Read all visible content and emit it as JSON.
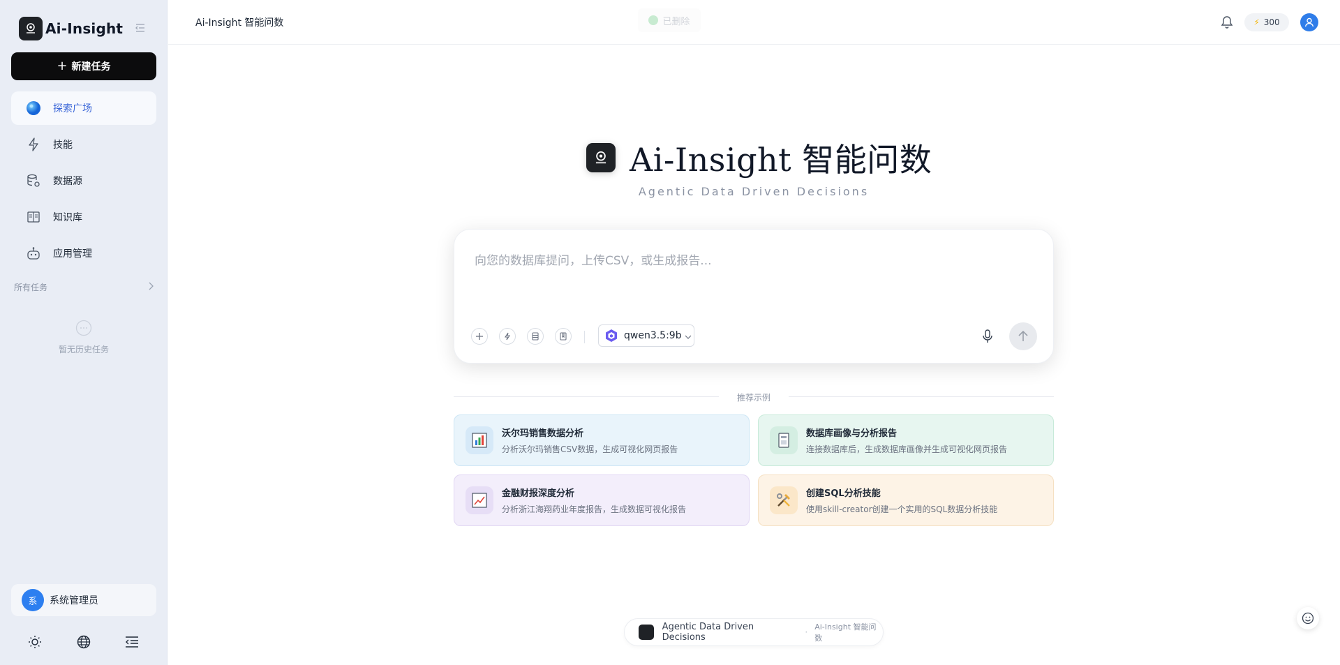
{
  "app": {
    "name": "Ai-Insight",
    "header_title": "Ai-Insight 智能问数",
    "toast_text": "已删除",
    "credits": "300"
  },
  "sidebar": {
    "new_task_label": "新建任务",
    "items": [
      {
        "label": "探索广场",
        "icon": "globe-icon",
        "active": true
      },
      {
        "label": "技能",
        "icon": "lightning-icon",
        "active": false
      },
      {
        "label": "数据源",
        "icon": "database-icon",
        "active": false
      },
      {
        "label": "知识库",
        "icon": "book-icon",
        "active": false
      },
      {
        "label": "应用管理",
        "icon": "robot-icon",
        "active": false
      }
    ],
    "all_tasks_label": "所有任务",
    "empty_text": "暂无历史任务",
    "user": {
      "avatar_text": "系",
      "name": "系统管理员"
    }
  },
  "hero": {
    "title": "Ai-Insight 智能问数",
    "subtitle": "Agentic Data Driven Decisions"
  },
  "composer": {
    "placeholder": "向您的数据库提问，上传CSV，或生成报告...",
    "model": "qwen3.5:9b"
  },
  "examples": {
    "label": "推荐示例",
    "cards": [
      {
        "title": "沃尔玛销售数据分析",
        "desc": "分析沃尔玛销售CSV数据，生成可视化网页报告",
        "icon": "bar-chart-icon"
      },
      {
        "title": "数据库画像与分析报告",
        "desc": "连接数据库后，生成数据库画像并生成可视化网页报告",
        "icon": "report-icon"
      },
      {
        "title": "金融财报深度分析",
        "desc": "分析浙江海翔药业年度报告，生成数据可视化报告",
        "icon": "trend-chart-icon"
      },
      {
        "title": "创建SQL分析技能",
        "desc": "使用skill-creator创建一个实用的SQL数据分析技能",
        "icon": "tools-icon"
      }
    ]
  },
  "footer": {
    "main": "Agentic Data Driven Decisions",
    "separator": "·",
    "sub": "Ai-Insight 智能问数"
  },
  "colors": {
    "accent": "#3a66d8",
    "sidebar_bg": "#e9edf5",
    "primary_button": "#0c0c0d"
  }
}
